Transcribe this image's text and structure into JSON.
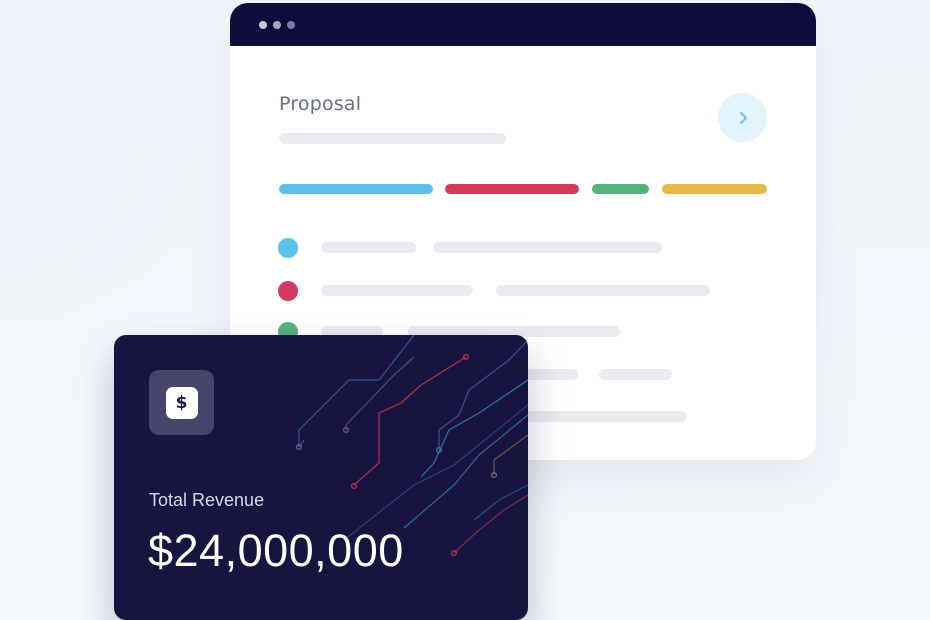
{
  "proposal": {
    "title": "Proposal"
  },
  "status_bars": [
    {
      "name": "blue",
      "color": "#5ec1ec"
    },
    {
      "name": "red",
      "color": "#d23c5d"
    },
    {
      "name": "green",
      "color": "#55b27a"
    },
    {
      "name": "yellow",
      "color": "#e6b84a"
    }
  ],
  "list_rows": [
    {
      "dot_color": "#5ec1ec"
    },
    {
      "dot_color": "#d23c5d"
    },
    {
      "dot_color": "#55b27a"
    }
  ],
  "revenue_card": {
    "icon": "dollar-icon",
    "icon_glyph": "$",
    "label": "Total Revenue",
    "value": "$24,000,000"
  },
  "colors": {
    "titlebar": "#0f0c3c",
    "card_background": "#17153f"
  }
}
